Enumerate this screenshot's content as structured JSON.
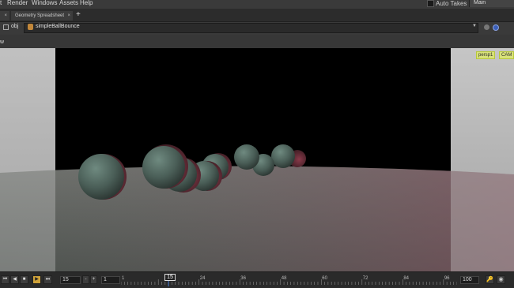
{
  "menu": {
    "items": [
      "t",
      "Render",
      "Windows",
      "Assets",
      "Help"
    ]
  },
  "takes": {
    "label": "Auto Takes",
    "desktop": "Main"
  },
  "tabs": [
    {
      "label": ""
    },
    {
      "label": "Geometry Spreadsheet"
    }
  ],
  "path": {
    "context": "obj",
    "node": "simpleBallBounce"
  },
  "view": {
    "label": "w"
  },
  "viewport": {
    "camera_menu": "persp1",
    "cam_menu": "CAM"
  },
  "timeline": {
    "current_frame": "15",
    "start_frame": "1",
    "end_frame": "100",
    "frame_field": "15",
    "ticks": [
      "1",
      "15",
      "24",
      "36",
      "48",
      "60",
      "72",
      "84",
      "96"
    ],
    "tick_numbers": [
      1,
      15,
      24,
      36,
      48,
      60,
      72,
      84,
      96
    ],
    "range": [
      1,
      100
    ]
  }
}
